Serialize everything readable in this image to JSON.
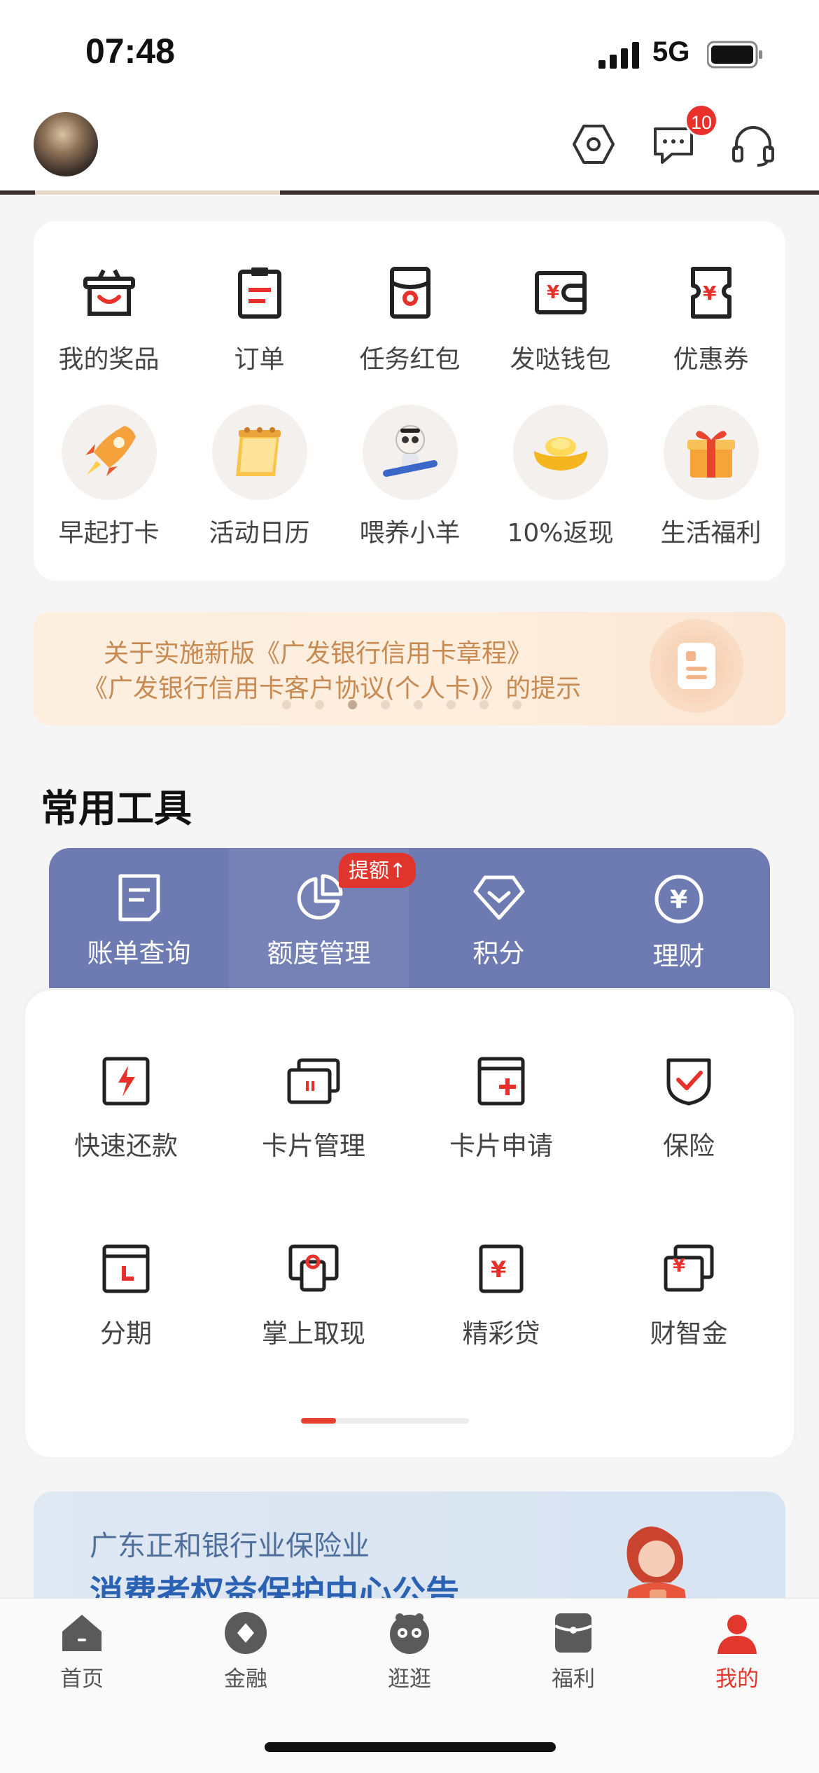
{
  "status_bar": {
    "time": "07:48",
    "network": "5G"
  },
  "header": {
    "messages_badge": "10"
  },
  "quick_links": [
    {
      "label": "我的奖品",
      "icon": "basket-smile-icon"
    },
    {
      "label": "订单",
      "icon": "clipboard-icon"
    },
    {
      "label": "任务红包",
      "icon": "red-envelope-icon"
    },
    {
      "label": "发哒钱包",
      "icon": "wallet-icon"
    },
    {
      "label": "优惠券",
      "icon": "coupon-icon"
    }
  ],
  "activities": [
    {
      "label": "早起打卡",
      "icon": "rocket-icon"
    },
    {
      "label": "活动日历",
      "icon": "calendar-icon"
    },
    {
      "label": "喂养小羊",
      "icon": "sheep-icon"
    },
    {
      "label": "10%返现",
      "icon": "gold-ingot-icon"
    },
    {
      "label": "生活福利",
      "icon": "gift-box-icon"
    }
  ],
  "notice": {
    "line1": "关于实施新版《广发银行信用卡章程》",
    "line2": "《广发银行信用卡客户协议(个人卡)》的提示"
  },
  "tools": {
    "title": "常用工具",
    "top": [
      {
        "label": "账单查询",
        "icon": "bill-icon"
      },
      {
        "label": "额度管理",
        "icon": "pie-chart-icon"
      },
      {
        "label": "积分",
        "icon": "diamond-icon"
      },
      {
        "label": "理财",
        "icon": "yen-circle-icon"
      }
    ],
    "limit_tag": "提额",
    "grid": [
      {
        "label": "快速还款",
        "icon": "lightning-card-icon"
      },
      {
        "label": "卡片管理",
        "icon": "cards-icon"
      },
      {
        "label": "卡片申请",
        "icon": "card-plus-icon"
      },
      {
        "label": "保险",
        "icon": "shield-check-icon"
      },
      {
        "label": "分期",
        "icon": "installment-icon"
      },
      {
        "label": "掌上取现",
        "icon": "cash-icon"
      },
      {
        "label": "精彩贷",
        "icon": "loan-icon"
      },
      {
        "label": "财智金",
        "icon": "finance-icon"
      }
    ]
  },
  "promo": {
    "line1": "广东正和银行业保险业",
    "line2": "消费者权益保护中心公告"
  },
  "tabbar": [
    {
      "label": "首页",
      "icon": "home-icon"
    },
    {
      "label": "金融",
      "icon": "finance-tab-icon"
    },
    {
      "label": "逛逛",
      "icon": "browse-icon"
    },
    {
      "label": "福利",
      "icon": "gift-tab-icon"
    },
    {
      "label": "我的",
      "icon": "profile-icon",
      "active": true
    }
  ],
  "colors": {
    "accent": "#e2372c",
    "tools_bar": "#6e7bb2",
    "notice_text": "#c78a53"
  }
}
